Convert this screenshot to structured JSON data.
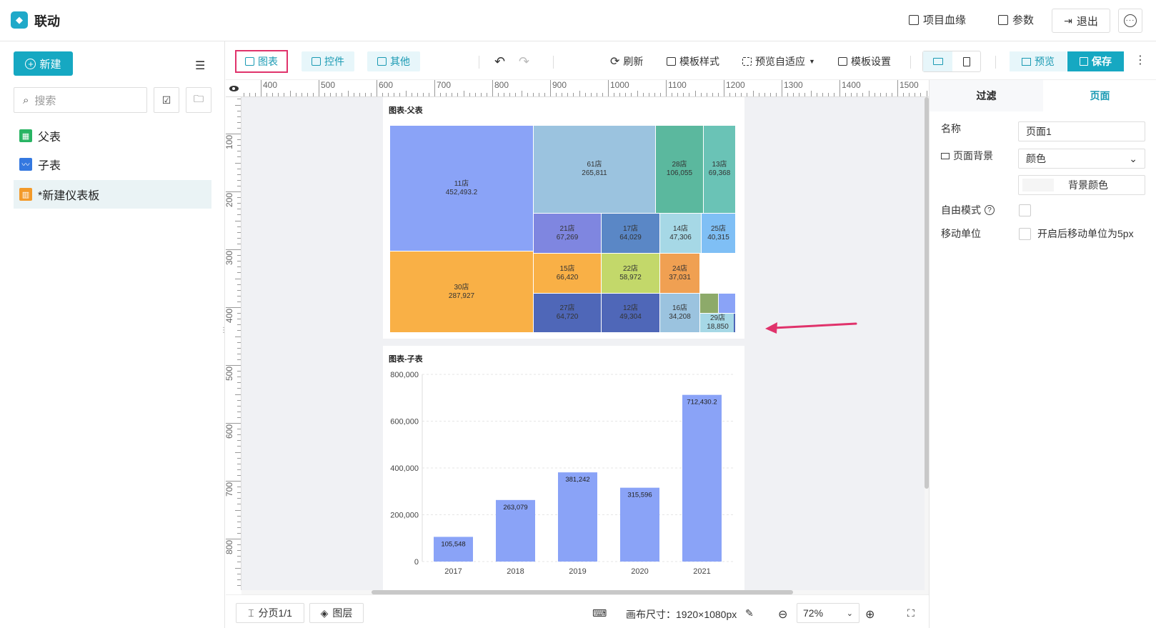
{
  "app": {
    "title": "联动"
  },
  "header": {
    "lineage": "项目血缘",
    "params": "参数",
    "exit": "退出"
  },
  "sidebar": {
    "new_label": "新建",
    "search_placeholder": "搜索",
    "items": [
      {
        "label": "父表",
        "icon": "table-icon"
      },
      {
        "label": "子表",
        "icon": "line-chart-icon"
      },
      {
        "label": "*新建仪表板",
        "icon": "dashboard-icon"
      }
    ]
  },
  "toolbar": {
    "chart": "图表",
    "control": "控件",
    "other": "其他",
    "refresh": "刷新",
    "template_style": "模板样式",
    "preview_adapt": "预览自适应",
    "template_settings": "模板设置",
    "preview": "预览",
    "save": "保存"
  },
  "rulers": {
    "h": [
      "400",
      "500",
      "600",
      "700",
      "800",
      "900",
      "1000",
      "1100",
      "1200",
      "1300",
      "1400",
      "1500"
    ],
    "v": [
      "100",
      "200",
      "300",
      "400",
      "500",
      "600",
      "700",
      "800"
    ]
  },
  "colors": {
    "accent": "#16a8c2",
    "bar": "#8aa3f7",
    "selection": "#e0336b"
  },
  "chart_data": [
    {
      "type": "treemap",
      "title": "图表-父表",
      "cells": [
        {
          "name": "11店",
          "value": "452,493.2",
          "color": "#8aa3f7"
        },
        {
          "name": "30店",
          "value": "287,927",
          "color": "#f9b046"
        },
        {
          "name": "61店",
          "value": "265,811",
          "color": "#9bc3df"
        },
        {
          "name": "28店",
          "value": "106,055",
          "color": "#5bb89e"
        },
        {
          "name": "13店",
          "value": "69,368",
          "color": "#6ac3b6"
        },
        {
          "name": "21店",
          "value": "67,269",
          "color": "#7f86e0"
        },
        {
          "name": "17店",
          "value": "64,029",
          "color": "#5a87c6"
        },
        {
          "name": "14店",
          "value": "47,306",
          "color": "#a6d8e6"
        },
        {
          "name": "25店",
          "value": "40,315",
          "color": "#7fbff5"
        },
        {
          "name": "15店",
          "value": "66,420",
          "color": "#f9b046"
        },
        {
          "name": "22店",
          "value": "58,972",
          "color": "#c3d86a"
        },
        {
          "name": "24店",
          "value": "37,031",
          "color": "#f0a052"
        },
        {
          "name": "27店",
          "value": "64,720",
          "color": "#4f67b8"
        },
        {
          "name": "12店",
          "value": "49,304",
          "color": "#4f67b8"
        },
        {
          "name": "16店",
          "value": "34,208",
          "color": "#9bc3df"
        },
        {
          "name": "29店",
          "value": "18,850",
          "color": "#a6d8e6"
        }
      ]
    },
    {
      "type": "bar",
      "title": "图表-子表",
      "categories": [
        "2017",
        "2018",
        "2019",
        "2020",
        "2021"
      ],
      "values": [
        105548,
        263079,
        381242,
        315596,
        712430.2
      ],
      "value_labels": [
        "105,548",
        "263,079",
        "381,242",
        "315,596",
        "712,430.2"
      ],
      "yticks": [
        "800,000",
        "600,000",
        "400,000",
        "200,000",
        "0"
      ],
      "ylim": [
        0,
        800000
      ]
    }
  ],
  "bottombar": {
    "pages": "分页1/1",
    "layers": "图层",
    "canvas_size": "画布尺寸：1920×1080px",
    "zoom": "72%"
  },
  "rpanel": {
    "tab_filter": "过滤",
    "tab_page": "页面",
    "name_label": "名称",
    "name_value": "页面1",
    "bg_label": "页面背景",
    "bg_value": "颜色",
    "bg_color_label": "背景颜色",
    "free_mode_label": "自由模式",
    "move_unit_label": "移动单位",
    "move_unit_text": "开启后移动单位为5px"
  }
}
